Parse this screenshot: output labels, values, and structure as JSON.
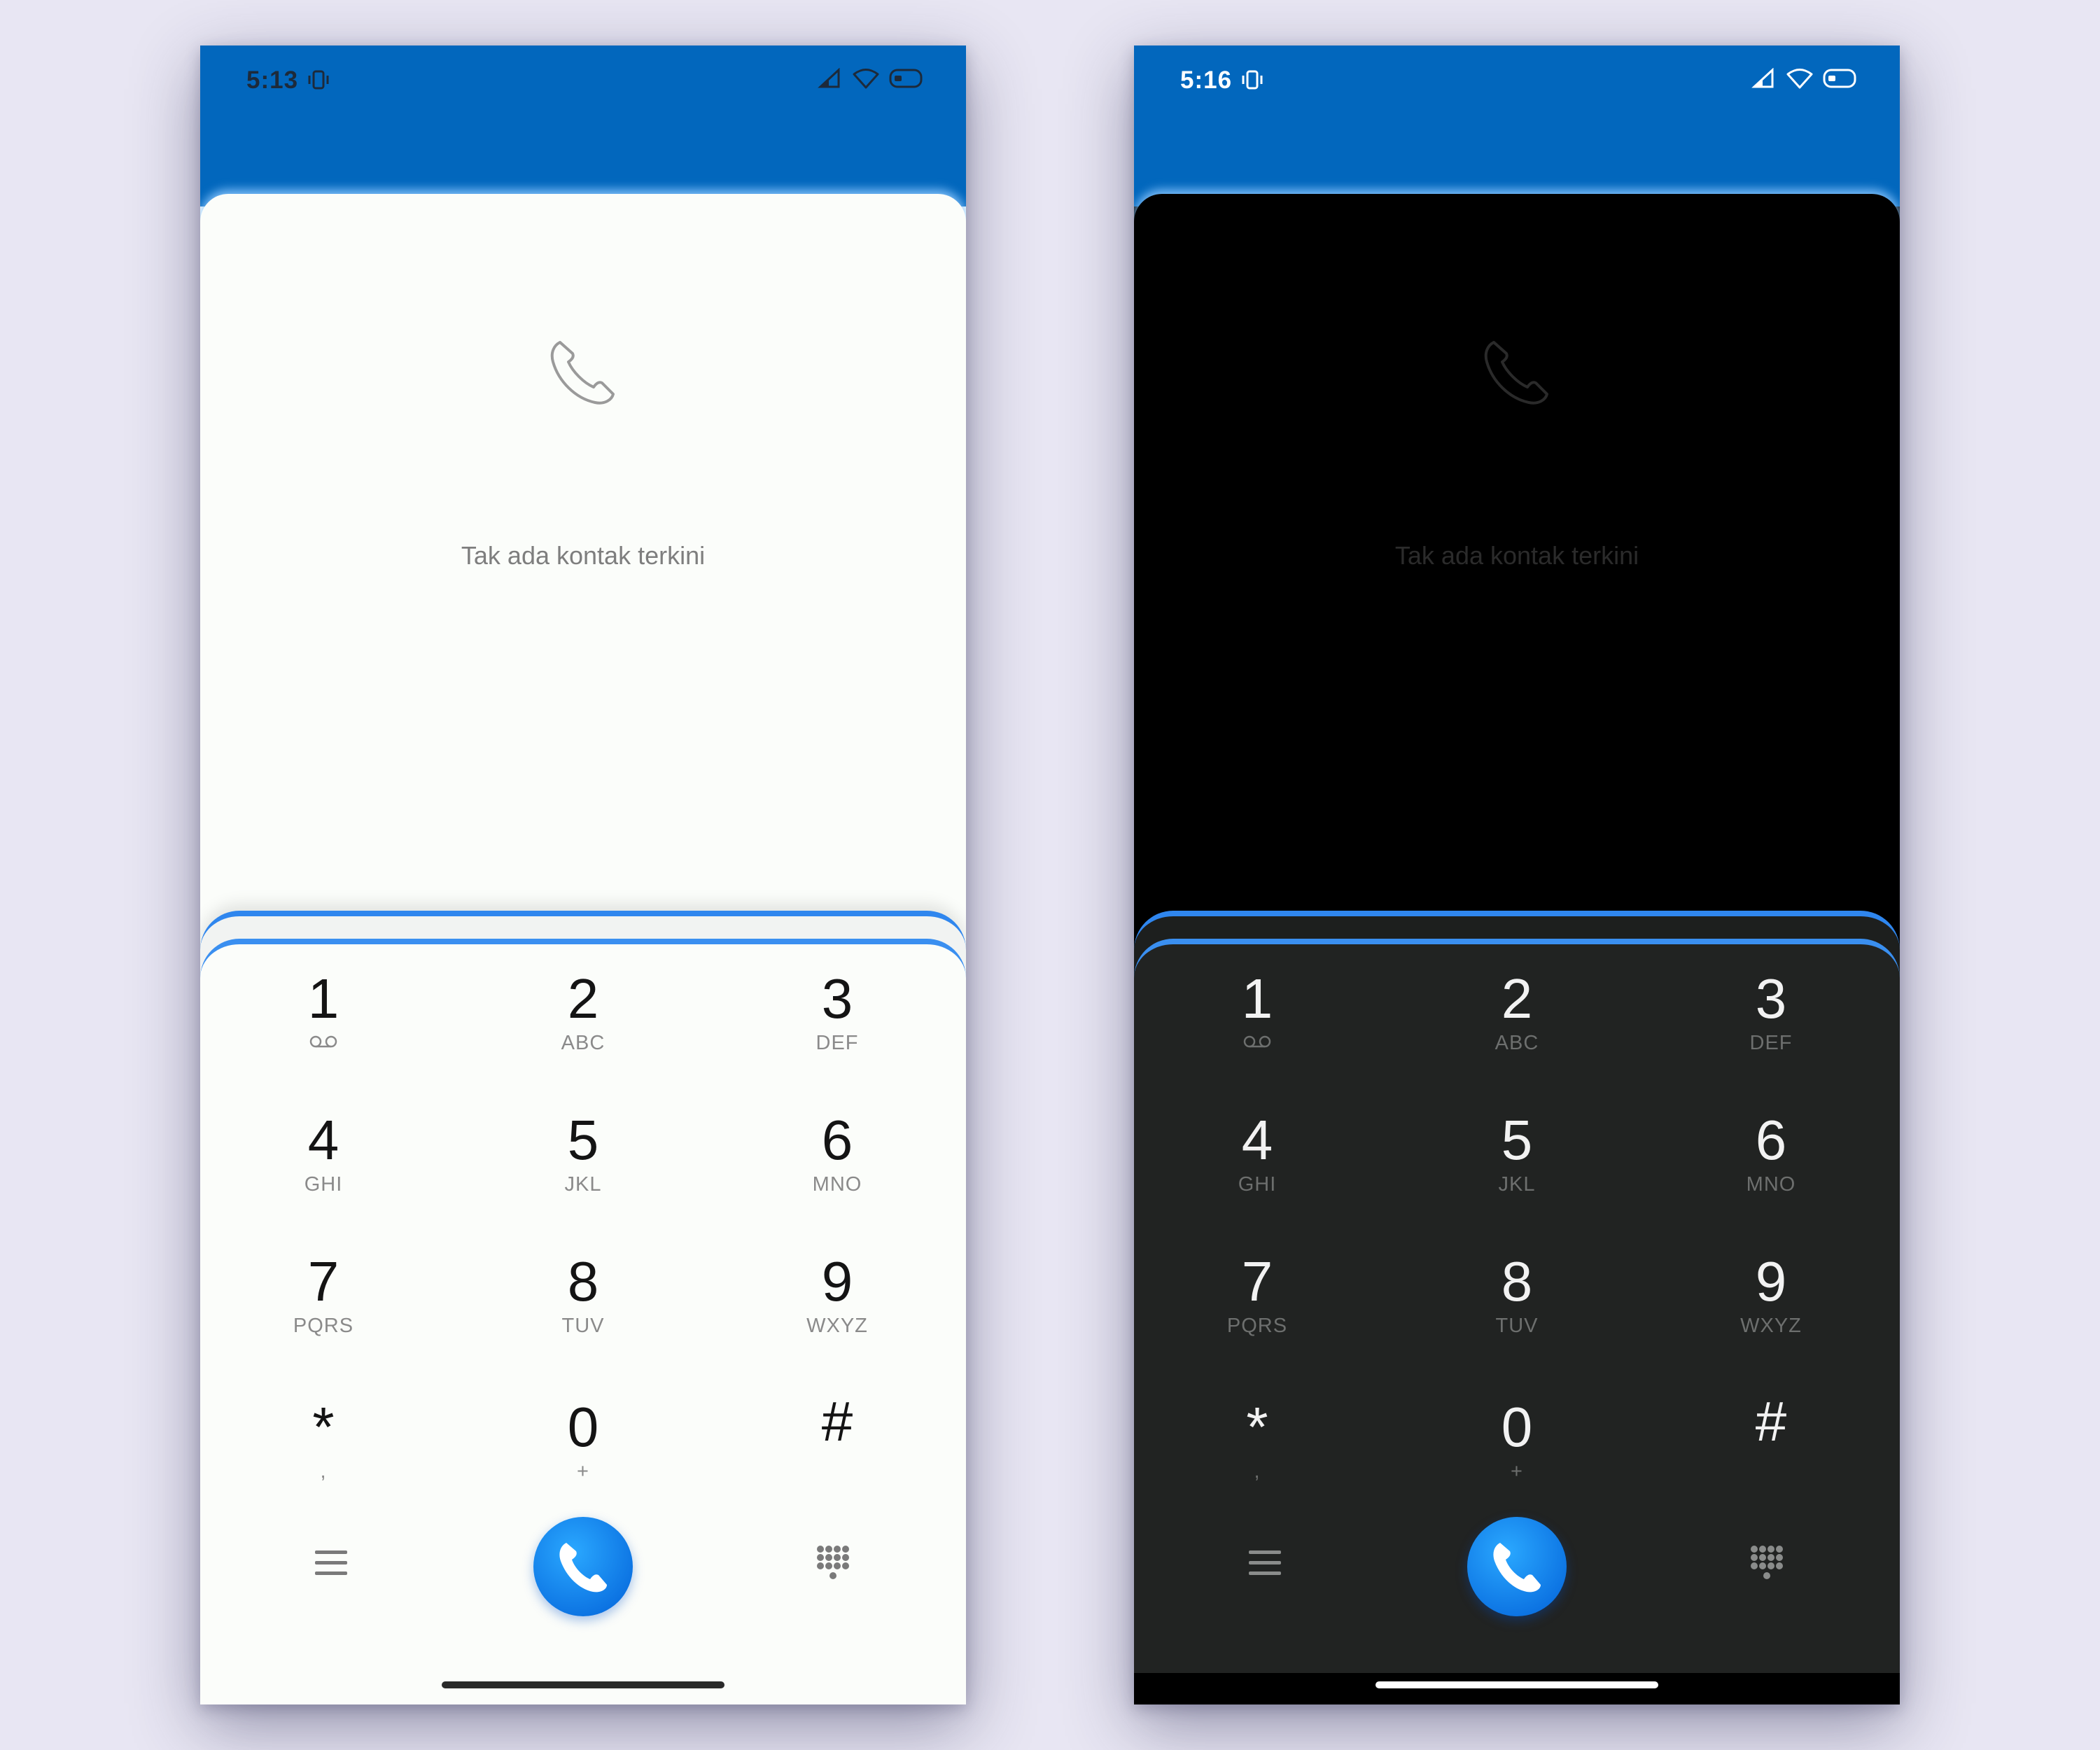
{
  "screens": [
    {
      "id": "light",
      "status_time": "5:13",
      "empty_message": "Tak ada kontak terkini"
    },
    {
      "id": "dark",
      "status_time": "5:16",
      "empty_message": "Tak ada kontak terkini"
    }
  ],
  "keypad": [
    {
      "digit": "1",
      "letters": ""
    },
    {
      "digit": "2",
      "letters": "ABC"
    },
    {
      "digit": "3",
      "letters": "DEF"
    },
    {
      "digit": "4",
      "letters": "GHI"
    },
    {
      "digit": "5",
      "letters": "JKL"
    },
    {
      "digit": "6",
      "letters": "MNO"
    },
    {
      "digit": "7",
      "letters": "PQRS"
    },
    {
      "digit": "8",
      "letters": "TUV"
    },
    {
      "digit": "9",
      "letters": "WXYZ"
    },
    {
      "digit": "*",
      "letters": ","
    },
    {
      "digit": "0",
      "letters": "+"
    },
    {
      "digit": "#",
      "letters": ""
    }
  ],
  "icons": {
    "voicemail": "voicemail-icon",
    "menu": "menu-icon",
    "call": "phone-call-icon",
    "dialpad": "dialpad-grid-icon",
    "empty_state": "phone-outline-icon"
  },
  "colors": {
    "header_blue": "#0267bd",
    "accent_blue": "#3a8ff0",
    "call_button": "#1a8cf5"
  }
}
